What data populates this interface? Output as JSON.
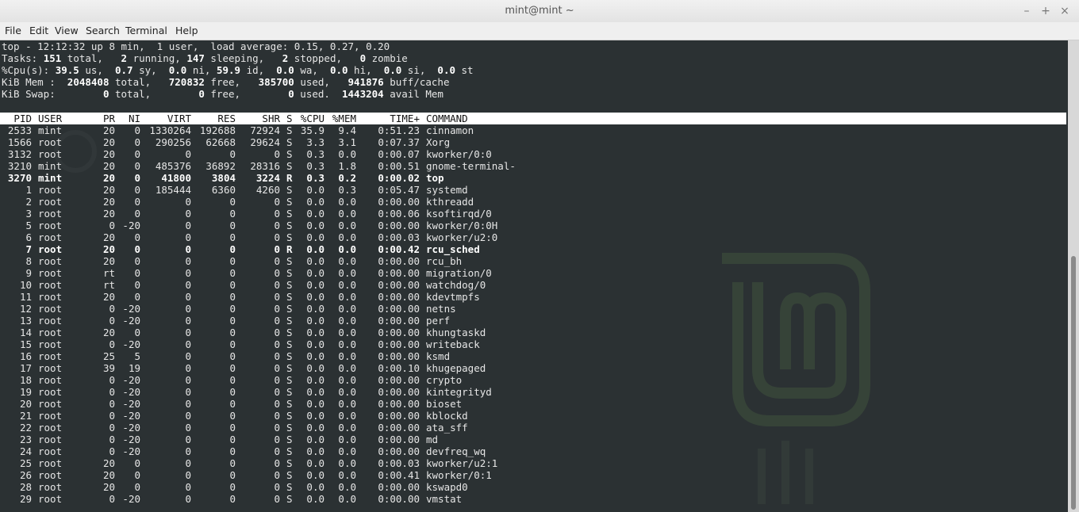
{
  "window": {
    "title": "mint@mint ~",
    "buttons": [
      "–",
      "+",
      "×"
    ]
  },
  "menu": [
    "File",
    "Edit",
    "View",
    "Search",
    "Terminal",
    "Help"
  ],
  "summary": {
    "top_prefix": "top - ",
    "time": "12:12:32",
    "uptime": " up 8 min,  1 user,  load average: 0.15, 0.27, 0.20",
    "tasks_label": "Tasks: ",
    "tasks_total": "151",
    "tasks_total_lbl": " total,   ",
    "tasks_running": "2",
    "tasks_running_lbl": " running, ",
    "tasks_sleeping": "147",
    "tasks_sleeping_lbl": " sleeping,   ",
    "tasks_stopped": "2",
    "tasks_stopped_lbl": " stopped,   ",
    "tasks_zombie": "0",
    "tasks_zombie_lbl": " zombie",
    "cpu_label": "%Cpu(s): ",
    "cpu_us": "39.5",
    "cpu_us_lbl": " us,  ",
    "cpu_sy": "0.7",
    "cpu_sy_lbl": " sy,  ",
    "cpu_ni": "0.0",
    "cpu_ni_lbl": " ni, ",
    "cpu_id": "59.9",
    "cpu_id_lbl": " id,  ",
    "cpu_wa": "0.0",
    "cpu_wa_lbl": " wa,  ",
    "cpu_hi": "0.0",
    "cpu_hi_lbl": " hi,  ",
    "cpu_si": "0.0",
    "cpu_si_lbl": " si,  ",
    "cpu_st": "0.0",
    "cpu_st_lbl": " st",
    "mem_label": "KiB Mem :  ",
    "mem_total": "2048408",
    "mem_total_lbl": " total,   ",
    "mem_free": "720832",
    "mem_free_lbl": " free,   ",
    "mem_used": "385700",
    "mem_used_lbl": " used,   ",
    "mem_buff": "941876",
    "mem_buff_lbl": " buff/cache",
    "swap_label": "KiB Swap:        ",
    "swap_total": "0",
    "swap_total_lbl": " total,        ",
    "swap_free": "0",
    "swap_free_lbl": " free,        ",
    "swap_used": "0",
    "swap_used_lbl": " used.  ",
    "swap_avail": "1443204",
    "swap_avail_lbl": " avail Mem"
  },
  "columns": [
    "PID",
    "USER",
    "PR",
    "NI",
    "VIRT",
    "RES",
    "SHR",
    "S",
    "%CPU",
    "%MEM",
    "TIME+",
    "COMMAND"
  ],
  "processes": [
    {
      "pid": "2533",
      "user": "mint",
      "pr": "20",
      "ni": "0",
      "virt": "1330264",
      "res": "192688",
      "shr": "72924",
      "s": "S",
      "cpu": "35.9",
      "mem": "9.4",
      "time": "0:51.23",
      "cmd": "cinnamon",
      "bold": false
    },
    {
      "pid": "1566",
      "user": "root",
      "pr": "20",
      "ni": "0",
      "virt": "290256",
      "res": "62668",
      "shr": "29624",
      "s": "S",
      "cpu": "3.3",
      "mem": "3.1",
      "time": "0:07.37",
      "cmd": "Xorg",
      "bold": false
    },
    {
      "pid": "3132",
      "user": "root",
      "pr": "20",
      "ni": "0",
      "virt": "0",
      "res": "0",
      "shr": "0",
      "s": "S",
      "cpu": "0.3",
      "mem": "0.0",
      "time": "0:00.07",
      "cmd": "kworker/0:0",
      "bold": false
    },
    {
      "pid": "3210",
      "user": "mint",
      "pr": "20",
      "ni": "0",
      "virt": "485376",
      "res": "36892",
      "shr": "28316",
      "s": "S",
      "cpu": "0.3",
      "mem": "1.8",
      "time": "0:00.51",
      "cmd": "gnome-terminal-",
      "bold": false
    },
    {
      "pid": "3270",
      "user": "mint",
      "pr": "20",
      "ni": "0",
      "virt": "41800",
      "res": "3804",
      "shr": "3224",
      "s": "R",
      "cpu": "0.3",
      "mem": "0.2",
      "time": "0:00.02",
      "cmd": "top",
      "bold": true
    },
    {
      "pid": "1",
      "user": "root",
      "pr": "20",
      "ni": "0",
      "virt": "185444",
      "res": "6360",
      "shr": "4260",
      "s": "S",
      "cpu": "0.0",
      "mem": "0.3",
      "time": "0:05.47",
      "cmd": "systemd",
      "bold": false
    },
    {
      "pid": "2",
      "user": "root",
      "pr": "20",
      "ni": "0",
      "virt": "0",
      "res": "0",
      "shr": "0",
      "s": "S",
      "cpu": "0.0",
      "mem": "0.0",
      "time": "0:00.00",
      "cmd": "kthreadd",
      "bold": false
    },
    {
      "pid": "3",
      "user": "root",
      "pr": "20",
      "ni": "0",
      "virt": "0",
      "res": "0",
      "shr": "0",
      "s": "S",
      "cpu": "0.0",
      "mem": "0.0",
      "time": "0:00.06",
      "cmd": "ksoftirqd/0",
      "bold": false
    },
    {
      "pid": "5",
      "user": "root",
      "pr": "0",
      "ni": "-20",
      "virt": "0",
      "res": "0",
      "shr": "0",
      "s": "S",
      "cpu": "0.0",
      "mem": "0.0",
      "time": "0:00.00",
      "cmd": "kworker/0:0H",
      "bold": false
    },
    {
      "pid": "6",
      "user": "root",
      "pr": "20",
      "ni": "0",
      "virt": "0",
      "res": "0",
      "shr": "0",
      "s": "S",
      "cpu": "0.0",
      "mem": "0.0",
      "time": "0:00.03",
      "cmd": "kworker/u2:0",
      "bold": false
    },
    {
      "pid": "7",
      "user": "root",
      "pr": "20",
      "ni": "0",
      "virt": "0",
      "res": "0",
      "shr": "0",
      "s": "R",
      "cpu": "0.0",
      "mem": "0.0",
      "time": "0:00.42",
      "cmd": "rcu_sched",
      "bold": true
    },
    {
      "pid": "8",
      "user": "root",
      "pr": "20",
      "ni": "0",
      "virt": "0",
      "res": "0",
      "shr": "0",
      "s": "S",
      "cpu": "0.0",
      "mem": "0.0",
      "time": "0:00.00",
      "cmd": "rcu_bh",
      "bold": false
    },
    {
      "pid": "9",
      "user": "root",
      "pr": "rt",
      "ni": "0",
      "virt": "0",
      "res": "0",
      "shr": "0",
      "s": "S",
      "cpu": "0.0",
      "mem": "0.0",
      "time": "0:00.00",
      "cmd": "migration/0",
      "bold": false
    },
    {
      "pid": "10",
      "user": "root",
      "pr": "rt",
      "ni": "0",
      "virt": "0",
      "res": "0",
      "shr": "0",
      "s": "S",
      "cpu": "0.0",
      "mem": "0.0",
      "time": "0:00.00",
      "cmd": "watchdog/0",
      "bold": false
    },
    {
      "pid": "11",
      "user": "root",
      "pr": "20",
      "ni": "0",
      "virt": "0",
      "res": "0",
      "shr": "0",
      "s": "S",
      "cpu": "0.0",
      "mem": "0.0",
      "time": "0:00.00",
      "cmd": "kdevtmpfs",
      "bold": false
    },
    {
      "pid": "12",
      "user": "root",
      "pr": "0",
      "ni": "-20",
      "virt": "0",
      "res": "0",
      "shr": "0",
      "s": "S",
      "cpu": "0.0",
      "mem": "0.0",
      "time": "0:00.00",
      "cmd": "netns",
      "bold": false
    },
    {
      "pid": "13",
      "user": "root",
      "pr": "0",
      "ni": "-20",
      "virt": "0",
      "res": "0",
      "shr": "0",
      "s": "S",
      "cpu": "0.0",
      "mem": "0.0",
      "time": "0:00.00",
      "cmd": "perf",
      "bold": false
    },
    {
      "pid": "14",
      "user": "root",
      "pr": "20",
      "ni": "0",
      "virt": "0",
      "res": "0",
      "shr": "0",
      "s": "S",
      "cpu": "0.0",
      "mem": "0.0",
      "time": "0:00.00",
      "cmd": "khungtaskd",
      "bold": false
    },
    {
      "pid": "15",
      "user": "root",
      "pr": "0",
      "ni": "-20",
      "virt": "0",
      "res": "0",
      "shr": "0",
      "s": "S",
      "cpu": "0.0",
      "mem": "0.0",
      "time": "0:00.00",
      "cmd": "writeback",
      "bold": false
    },
    {
      "pid": "16",
      "user": "root",
      "pr": "25",
      "ni": "5",
      "virt": "0",
      "res": "0",
      "shr": "0",
      "s": "S",
      "cpu": "0.0",
      "mem": "0.0",
      "time": "0:00.00",
      "cmd": "ksmd",
      "bold": false
    },
    {
      "pid": "17",
      "user": "root",
      "pr": "39",
      "ni": "19",
      "virt": "0",
      "res": "0",
      "shr": "0",
      "s": "S",
      "cpu": "0.0",
      "mem": "0.0",
      "time": "0:00.10",
      "cmd": "khugepaged",
      "bold": false
    },
    {
      "pid": "18",
      "user": "root",
      "pr": "0",
      "ni": "-20",
      "virt": "0",
      "res": "0",
      "shr": "0",
      "s": "S",
      "cpu": "0.0",
      "mem": "0.0",
      "time": "0:00.00",
      "cmd": "crypto",
      "bold": false
    },
    {
      "pid": "19",
      "user": "root",
      "pr": "0",
      "ni": "-20",
      "virt": "0",
      "res": "0",
      "shr": "0",
      "s": "S",
      "cpu": "0.0",
      "mem": "0.0",
      "time": "0:00.00",
      "cmd": "kintegrityd",
      "bold": false
    },
    {
      "pid": "20",
      "user": "root",
      "pr": "0",
      "ni": "-20",
      "virt": "0",
      "res": "0",
      "shr": "0",
      "s": "S",
      "cpu": "0.0",
      "mem": "0.0",
      "time": "0:00.00",
      "cmd": "bioset",
      "bold": false
    },
    {
      "pid": "21",
      "user": "root",
      "pr": "0",
      "ni": "-20",
      "virt": "0",
      "res": "0",
      "shr": "0",
      "s": "S",
      "cpu": "0.0",
      "mem": "0.0",
      "time": "0:00.00",
      "cmd": "kblockd",
      "bold": false
    },
    {
      "pid": "22",
      "user": "root",
      "pr": "0",
      "ni": "-20",
      "virt": "0",
      "res": "0",
      "shr": "0",
      "s": "S",
      "cpu": "0.0",
      "mem": "0.0",
      "time": "0:00.00",
      "cmd": "ata_sff",
      "bold": false
    },
    {
      "pid": "23",
      "user": "root",
      "pr": "0",
      "ni": "-20",
      "virt": "0",
      "res": "0",
      "shr": "0",
      "s": "S",
      "cpu": "0.0",
      "mem": "0.0",
      "time": "0:00.00",
      "cmd": "md",
      "bold": false
    },
    {
      "pid": "24",
      "user": "root",
      "pr": "0",
      "ni": "-20",
      "virt": "0",
      "res": "0",
      "shr": "0",
      "s": "S",
      "cpu": "0.0",
      "mem": "0.0",
      "time": "0:00.00",
      "cmd": "devfreq_wq",
      "bold": false
    },
    {
      "pid": "25",
      "user": "root",
      "pr": "20",
      "ni": "0",
      "virt": "0",
      "res": "0",
      "shr": "0",
      "s": "S",
      "cpu": "0.0",
      "mem": "0.0",
      "time": "0:00.03",
      "cmd": "kworker/u2:1",
      "bold": false
    },
    {
      "pid": "26",
      "user": "root",
      "pr": "20",
      "ni": "0",
      "virt": "0",
      "res": "0",
      "shr": "0",
      "s": "S",
      "cpu": "0.0",
      "mem": "0.0",
      "time": "0:00.41",
      "cmd": "kworker/0:1",
      "bold": false
    },
    {
      "pid": "28",
      "user": "root",
      "pr": "20",
      "ni": "0",
      "virt": "0",
      "res": "0",
      "shr": "0",
      "s": "S",
      "cpu": "0.0",
      "mem": "0.0",
      "time": "0:00.00",
      "cmd": "kswapd0",
      "bold": false
    },
    {
      "pid": "29",
      "user": "root",
      "pr": "0",
      "ni": "-20",
      "virt": "0",
      "res": "0",
      "shr": "0",
      "s": "S",
      "cpu": "0.0",
      "mem": "0.0",
      "time": "0:00.00",
      "cmd": "vmstat",
      "bold": false
    }
  ]
}
